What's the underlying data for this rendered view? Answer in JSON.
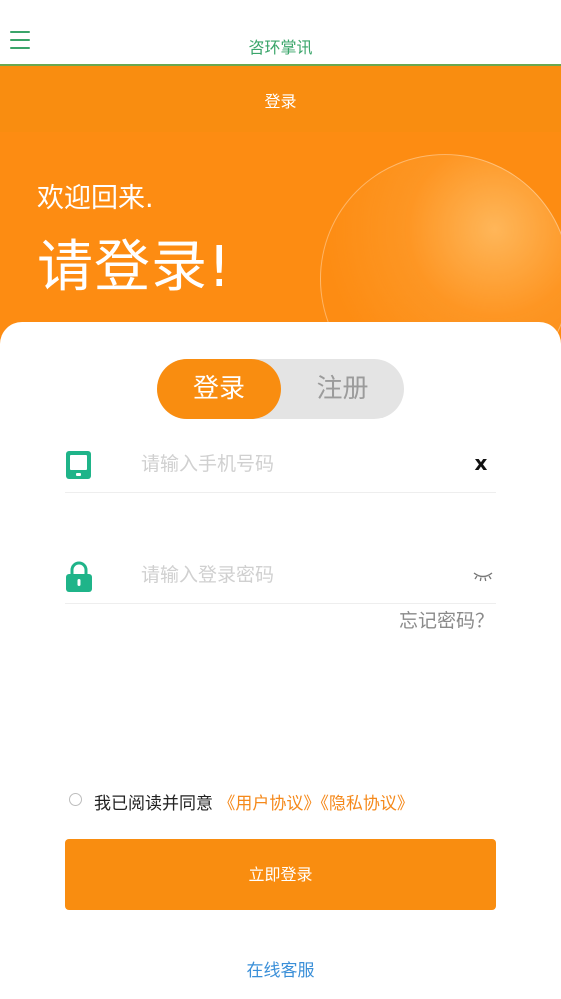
{
  "appbar": {
    "title": "咨环掌讯",
    "menu_icon": "hamburger-menu-icon"
  },
  "header": {
    "title": "登录",
    "welcome": "欢迎回来.",
    "headline": "请登录!",
    "color": "#f98d10"
  },
  "tabs": {
    "login": "登录",
    "register": "注册"
  },
  "form": {
    "phone_placeholder": "请输入手机号码",
    "phone_value": "",
    "clear_icon": "x",
    "password_placeholder": "请输入登录密码",
    "password_value": "",
    "forgot": "忘记密码？"
  },
  "agreement": {
    "text": "我已阅读并同意",
    "user_link": "《用户协议》",
    "privacy_link": "《隐私协议》",
    "checked": false
  },
  "submit_label": "立即登录",
  "service_label": "在线客服",
  "colors": {
    "accent": "#f98d10",
    "green": "#3aa56a",
    "link_blue": "#3a8fd8",
    "icon_teal": "#1fb489"
  }
}
